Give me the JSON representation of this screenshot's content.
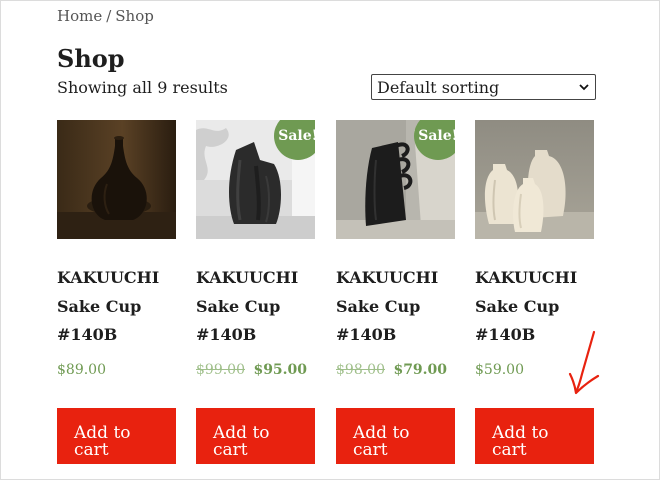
{
  "breadcrumb": {
    "home": "Home",
    "separator": "/",
    "current": "Shop"
  },
  "page_title": "Shop",
  "result_count": "Showing all 9 results",
  "sorting": {
    "selected": "Default sorting",
    "icon": "chevron-down-icon"
  },
  "colors": {
    "sale_badge": "#6f9a52",
    "price": "#6f9a52",
    "add_to_cart": "#e8220f",
    "annotation_arrow": "#e8220f"
  },
  "products": [
    {
      "title_line1": "KAKUUCHI",
      "title_line2": "Sake Cup",
      "title_line3": "#140B",
      "old_price": "",
      "price": "$89.00",
      "sale": false,
      "sale_label": "",
      "button_label": "Add to\ncart",
      "image": "dark-round-vase-photo"
    },
    {
      "title_line1": "KAKUUCHI",
      "title_line2": "Sake Cup",
      "title_line3": "#140B",
      "old_price": "$99.00",
      "price": "$95.00",
      "sale": true,
      "sale_label": "Sale!",
      "button_label": "Add to\ncart",
      "image": "black-textured-vase-photo"
    },
    {
      "title_line1": "KAKUUCHI",
      "title_line2": "Sake Cup",
      "title_line3": "#140B",
      "old_price": "$98.00",
      "price": "$79.00",
      "sale": true,
      "sale_label": "Sale!",
      "button_label": "Add to\ncart",
      "image": "black-handled-vase-photo"
    },
    {
      "title_line1": "KAKUUCHI",
      "title_line2": "Sake Cup",
      "title_line3": "#140B",
      "old_price": "",
      "price": "$59.00",
      "sale": false,
      "sale_label": "",
      "button_label": "Add to\ncart",
      "image": "cream-vases-photo"
    }
  ],
  "annotation": {
    "icon": "red-arrow-icon"
  }
}
